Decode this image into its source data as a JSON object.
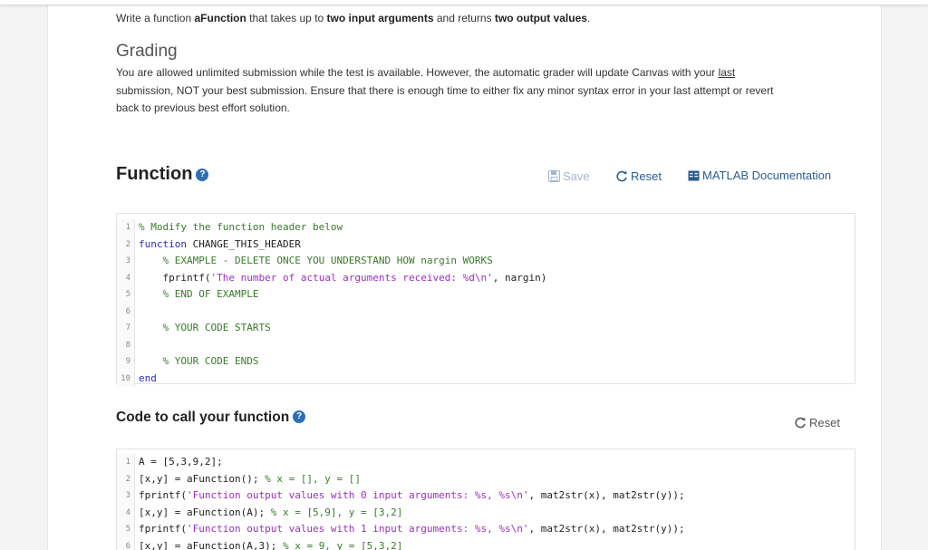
{
  "intro": {
    "t1": "Write a function ",
    "b1": "aFunction",
    "t2": " that takes up to ",
    "b2": "two input arguments",
    "t3": " and returns ",
    "b3": "two output values",
    "t4": "."
  },
  "grading": {
    "title": "Grading",
    "text1": "You are allowed unlimited submission while the test is available. However, the automatic grader will update Canvas with your ",
    "link": "last",
    "text2": "submission, NOT your best submission. Ensure that there is enough time to either fix any minor syntax error in your last attempt or revert",
    "text3": "back to previous best effort solution."
  },
  "function_section": {
    "title": "Function",
    "help_icon": "question-circle-icon",
    "save_label": "Save",
    "reset_label": "Reset",
    "docs_label": "MATLAB Documentation"
  },
  "editor1": [
    {
      "n": "1",
      "parts": [
        [
          "cm",
          "% Modify the function header below"
        ]
      ]
    },
    {
      "n": "2",
      "parts": [
        [
          "kw",
          "function"
        ],
        [
          "",
          " CHANGE_THIS_HEADER"
        ]
      ]
    },
    {
      "n": "3",
      "parts": [
        [
          "",
          "    "
        ],
        [
          "cm",
          "% EXAMPLE - DELETE ONCE YOU UNDERSTAND HOW nargin WORKS"
        ]
      ]
    },
    {
      "n": "4",
      "parts": [
        [
          "",
          "    fprintf("
        ],
        [
          "str",
          "'The number of actual arguments received: %d\\n'"
        ],
        [
          "",
          ", nargin)"
        ]
      ]
    },
    {
      "n": "5",
      "parts": [
        [
          "",
          "    "
        ],
        [
          "cm",
          "% END OF EXAMPLE"
        ]
      ]
    },
    {
      "n": "6",
      "parts": [
        [
          "",
          ""
        ]
      ]
    },
    {
      "n": "7",
      "parts": [
        [
          "",
          "    "
        ],
        [
          "cm",
          "% YOUR CODE STARTS"
        ]
      ]
    },
    {
      "n": "8",
      "parts": [
        [
          "",
          ""
        ]
      ]
    },
    {
      "n": "9",
      "parts": [
        [
          "",
          "    "
        ],
        [
          "cm",
          "% YOUR CODE ENDS"
        ]
      ]
    },
    {
      "n": "10",
      "parts": [
        [
          "kw",
          "end"
        ]
      ]
    }
  ],
  "call_section": {
    "title": "Code to call your function",
    "help_icon": "question-circle-icon",
    "reset_label": "Reset"
  },
  "editor2": [
    {
      "n": "1",
      "parts": [
        [
          "",
          "A = [5,3,9,2];"
        ]
      ]
    },
    {
      "n": "2",
      "parts": [
        [
          "",
          "[x,y] = aFunction(); "
        ],
        [
          "cm",
          "% x = [], y = []"
        ]
      ]
    },
    {
      "n": "3",
      "parts": [
        [
          "",
          "fprintf("
        ],
        [
          "str",
          "'Function output values with 0 input arguments: %s, %s\\n'"
        ],
        [
          "",
          ", mat2str(x), mat2str(y));"
        ]
      ]
    },
    {
      "n": "4",
      "parts": [
        [
          "",
          "[x,y] = aFunction(A); "
        ],
        [
          "cm",
          "% x = [5,9], y = [3,2]"
        ]
      ]
    },
    {
      "n": "5",
      "parts": [
        [
          "",
          "fprintf("
        ],
        [
          "str",
          "'Function output values with 1 input arguments: %s, %s\\n'"
        ],
        [
          "",
          ", mat2str(x), mat2str(y));"
        ]
      ]
    },
    {
      "n": "6",
      "parts": [
        [
          "",
          "[x,y] = aFunction(A,3); "
        ],
        [
          "cm",
          "% x = 9, y = [5,3,2]"
        ]
      ]
    }
  ]
}
